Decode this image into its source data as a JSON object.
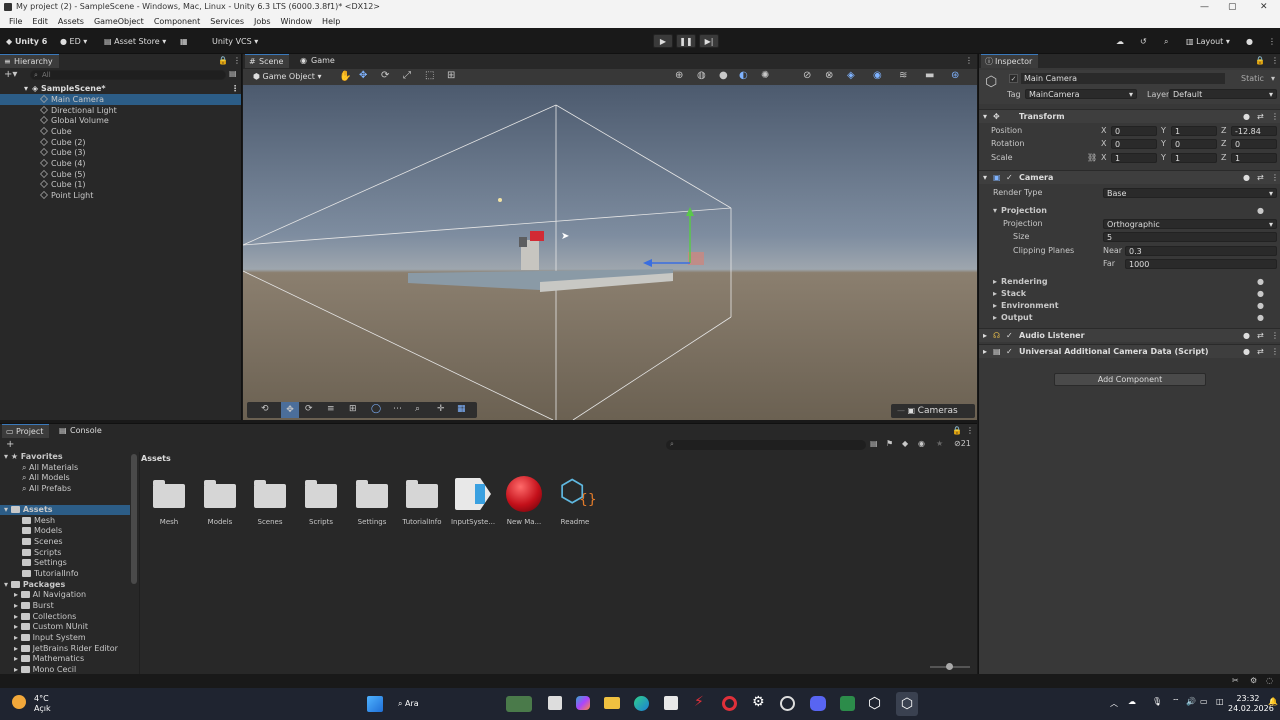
{
  "window": {
    "title": "My project (2) - SampleScene - Windows, Mac, Linux - Unity 6.3 LTS (6000.3.8f1)* <DX12>"
  },
  "menu": [
    "File",
    "Edit",
    "Assets",
    "GameObject",
    "Component",
    "Services",
    "Jobs",
    "Window",
    "Help"
  ],
  "toolbar": {
    "account": "Unity 6",
    "ed": "ED",
    "asset_store": "Asset Store",
    "vcs": "Unity VCS",
    "layout": "Layout"
  },
  "hierarchy": {
    "tab": "Hierarchy",
    "search_placeholder": "All",
    "scene": "SampleScene*",
    "items": [
      "Main Camera",
      "Directional Light",
      "Global Volume",
      "Cube",
      "Cube (2)",
      "Cube (3)",
      "Cube (4)",
      "Cube (5)",
      "Cube (1)",
      "Point Light"
    ]
  },
  "scene": {
    "tab_scene": "Scene",
    "tab_game": "Game",
    "gameobject_dropdown": "Game Object",
    "cameras_label": "Cameras"
  },
  "inspector": {
    "tab": "Inspector",
    "object_name": "Main Camera",
    "static_label": "Static",
    "tag_label": "Tag",
    "tag_value": "MainCamera",
    "layer_label": "Layer",
    "layer_value": "Default",
    "transform": {
      "title": "Transform",
      "position_label": "Position",
      "rotation_label": "Rotation",
      "scale_label": "Scale",
      "position": [
        "0",
        "1",
        "-12.84"
      ],
      "rotation": [
        "0",
        "0",
        "0"
      ],
      "scale": [
        "1",
        "1",
        "1"
      ]
    },
    "camera": {
      "title": "Camera",
      "render_type_label": "Render Type",
      "render_type": "Base",
      "projection_section": "Projection",
      "projection_label": "Projection",
      "projection": "Orthographic",
      "size_label": "Size",
      "size": "5",
      "clipping_label": "Clipping Planes",
      "near_label": "Near",
      "near": "0.3",
      "far_label": "Far",
      "far": "1000",
      "rendering": "Rendering",
      "stack": "Stack",
      "environment": "Environment",
      "output": "Output"
    },
    "audio_listener": "Audio Listener",
    "uacd": "Universal Additional Camera Data (Script)",
    "add_component": "Add Component"
  },
  "project": {
    "tab_project": "Project",
    "tab_console": "Console",
    "hidden_count": "21",
    "favorites": "Favorites",
    "fav_items": [
      "All Materials",
      "All Models",
      "All Prefabs"
    ],
    "assets_root": "Assets",
    "asset_folders": [
      "Mesh",
      "Models",
      "Scenes",
      "Scripts",
      "Settings",
      "TutorialInfo"
    ],
    "packages": "Packages",
    "package_items": [
      "AI Navigation",
      "Burst",
      "Collections",
      "Custom NUnit",
      "Input System",
      "JetBrains Rider Editor",
      "Mathematics",
      "Mono Cecil"
    ],
    "breadcrumb": "Assets",
    "grid": [
      "Mesh",
      "Models",
      "Scenes",
      "Scripts",
      "Settings",
      "TutorialInfo",
      "InputSyste...",
      "New Ma...",
      "Readme"
    ]
  },
  "taskbar": {
    "weather_temp": "4°C",
    "weather_text": "Açık",
    "search": "Ara",
    "time": "23:32",
    "date": "24.02.2026"
  }
}
